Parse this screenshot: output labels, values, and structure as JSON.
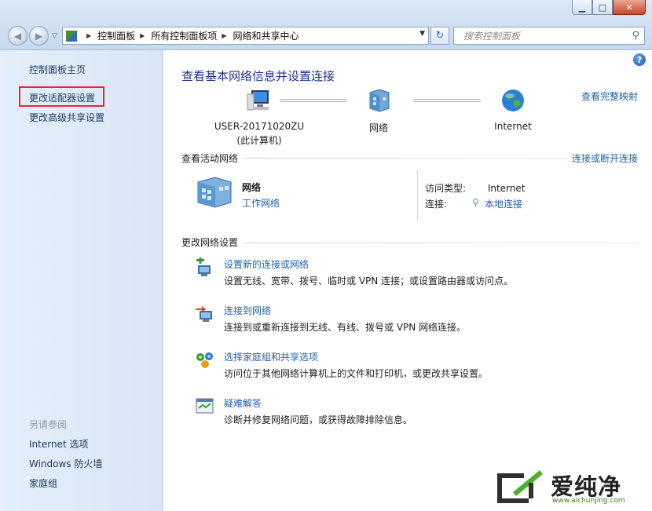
{
  "window": {
    "controls": {
      "minimize": "▁",
      "maximize": "□",
      "close": "✕"
    }
  },
  "address_bar": {
    "crumbs": [
      "控制面板",
      "所有控制面板项",
      "网络和共享中心"
    ],
    "search_placeholder": "搜索控制面板"
  },
  "left_pane": {
    "items": [
      "控制面板主页",
      "更改适配器设置",
      "更改高级共享设置"
    ],
    "see_also_header": "另请参阅",
    "see_also": [
      "Internet 选项",
      "Windows 防火墙",
      "家庭组"
    ]
  },
  "main": {
    "help": "?",
    "title": "查看基本网络信息并设置连接",
    "full_map_link": "查看完整映射",
    "map": {
      "computer_name": "USER-20171020ZU",
      "computer_sub": "(此计算机)",
      "network": "网络",
      "internet": "Internet"
    },
    "active_networks": {
      "header": "查看活动网络",
      "connect_link": "连接或断开连接",
      "name": "网络",
      "type": "工作网络",
      "access_type_label": "访问类型:",
      "access_type_value": "Internet",
      "connections_label": "连接:",
      "connections_value": "本地连接"
    },
    "change_settings": {
      "header": "更改网络设置",
      "tasks": [
        {
          "title": "设置新的连接或网络",
          "desc": "设置无线、宽带、拨号、临时或 VPN 连接；或设置路由器或访问点。"
        },
        {
          "title": "连接到网络",
          "desc": "连接到或重新连接到无线、有线、拨号或 VPN 网络连接。"
        },
        {
          "title": "选择家庭组和共享选项",
          "desc": "访问位于其他网络计算机上的文件和打印机，或更改共享设置。"
        },
        {
          "title": "疑难解答",
          "desc": "诊断并修复网络问题，或获得故障排除信息。"
        }
      ]
    }
  },
  "watermark": {
    "text": "爱纯净",
    "url": "www.aichunjing.com"
  }
}
